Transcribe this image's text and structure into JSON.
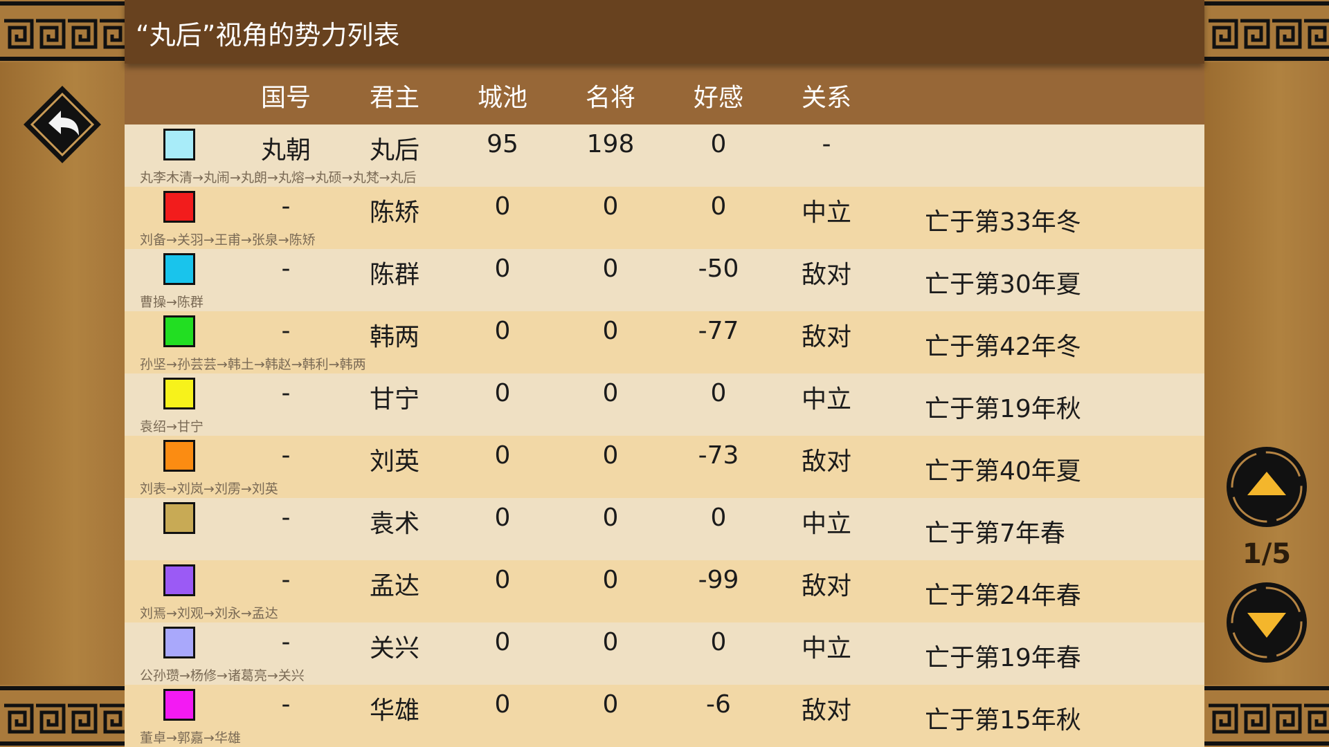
{
  "title": "“丸后”视角的势力列表",
  "header": [
    "国号",
    "君主",
    "城池",
    "名将",
    "好感",
    "关系"
  ],
  "rows": [
    {
      "color": "#a8ecf9",
      "nation": "丸朝",
      "ruler": "丸后",
      "cities": "95",
      "generals": "198",
      "favor": "0",
      "relation": "-",
      "status": "",
      "lineage": "丸李木清→丸闹→丸朗→丸熔→丸硕→丸梵→丸后"
    },
    {
      "color": "#f21c1c",
      "nation": "-",
      "ruler": "陈矫",
      "cities": "0",
      "generals": "0",
      "favor": "0",
      "relation": "中立",
      "status": "亡于第33年冬",
      "lineage": "刘备→关羽→王甫→张泉→陈矫"
    },
    {
      "color": "#19c4ec",
      "nation": "-",
      "ruler": "陈群",
      "cities": "0",
      "generals": "0",
      "favor": "-50",
      "relation": "敌对",
      "status": "亡于第30年夏",
      "lineage": "曹操→陈群"
    },
    {
      "color": "#22de22",
      "nation": "-",
      "ruler": "韩两",
      "cities": "0",
      "generals": "0",
      "favor": "-77",
      "relation": "敌对",
      "status": "亡于第42年冬",
      "lineage": "孙坚→孙芸芸→韩土→韩赵→韩利→韩两"
    },
    {
      "color": "#f7f21b",
      "nation": "-",
      "ruler": "甘宁",
      "cities": "0",
      "generals": "0",
      "favor": "0",
      "relation": "中立",
      "status": "亡于第19年秋",
      "lineage": "袁绍→甘宁"
    },
    {
      "color": "#fb8c12",
      "nation": "-",
      "ruler": "刘英",
      "cities": "0",
      "generals": "0",
      "favor": "-73",
      "relation": "敌对",
      "status": "亡于第40年夏",
      "lineage": "刘表→刘岚→刘雳→刘英"
    },
    {
      "color": "#c8aa55",
      "nation": "-",
      "ruler": "袁术",
      "cities": "0",
      "generals": "0",
      "favor": "0",
      "relation": "中立",
      "status": "亡于第7年春",
      "lineage": ""
    },
    {
      "color": "#9b5af5",
      "nation": "-",
      "ruler": "孟达",
      "cities": "0",
      "generals": "0",
      "favor": "-99",
      "relation": "敌对",
      "status": "亡于第24年春",
      "lineage": "刘焉→刘观→刘永→孟达"
    },
    {
      "color": "#a9a8fb",
      "nation": "-",
      "ruler": "关兴",
      "cities": "0",
      "generals": "0",
      "favor": "0",
      "relation": "中立",
      "status": "亡于第19年春",
      "lineage": "公孙瓒→杨修→诸葛亮→关兴"
    },
    {
      "color": "#f31af3",
      "nation": "-",
      "ruler": "华雄",
      "cities": "0",
      "generals": "0",
      "favor": "-6",
      "relation": "敌对",
      "status": "亡于第15年秋",
      "lineage": "董卓→郭嘉→华雄"
    }
  ],
  "pager": "1/5",
  "icons": {
    "back": "back-arrow-icon",
    "up": "up-arrow-icon",
    "down": "down-arrow-icon",
    "fret": "greek-key-ornament"
  }
}
